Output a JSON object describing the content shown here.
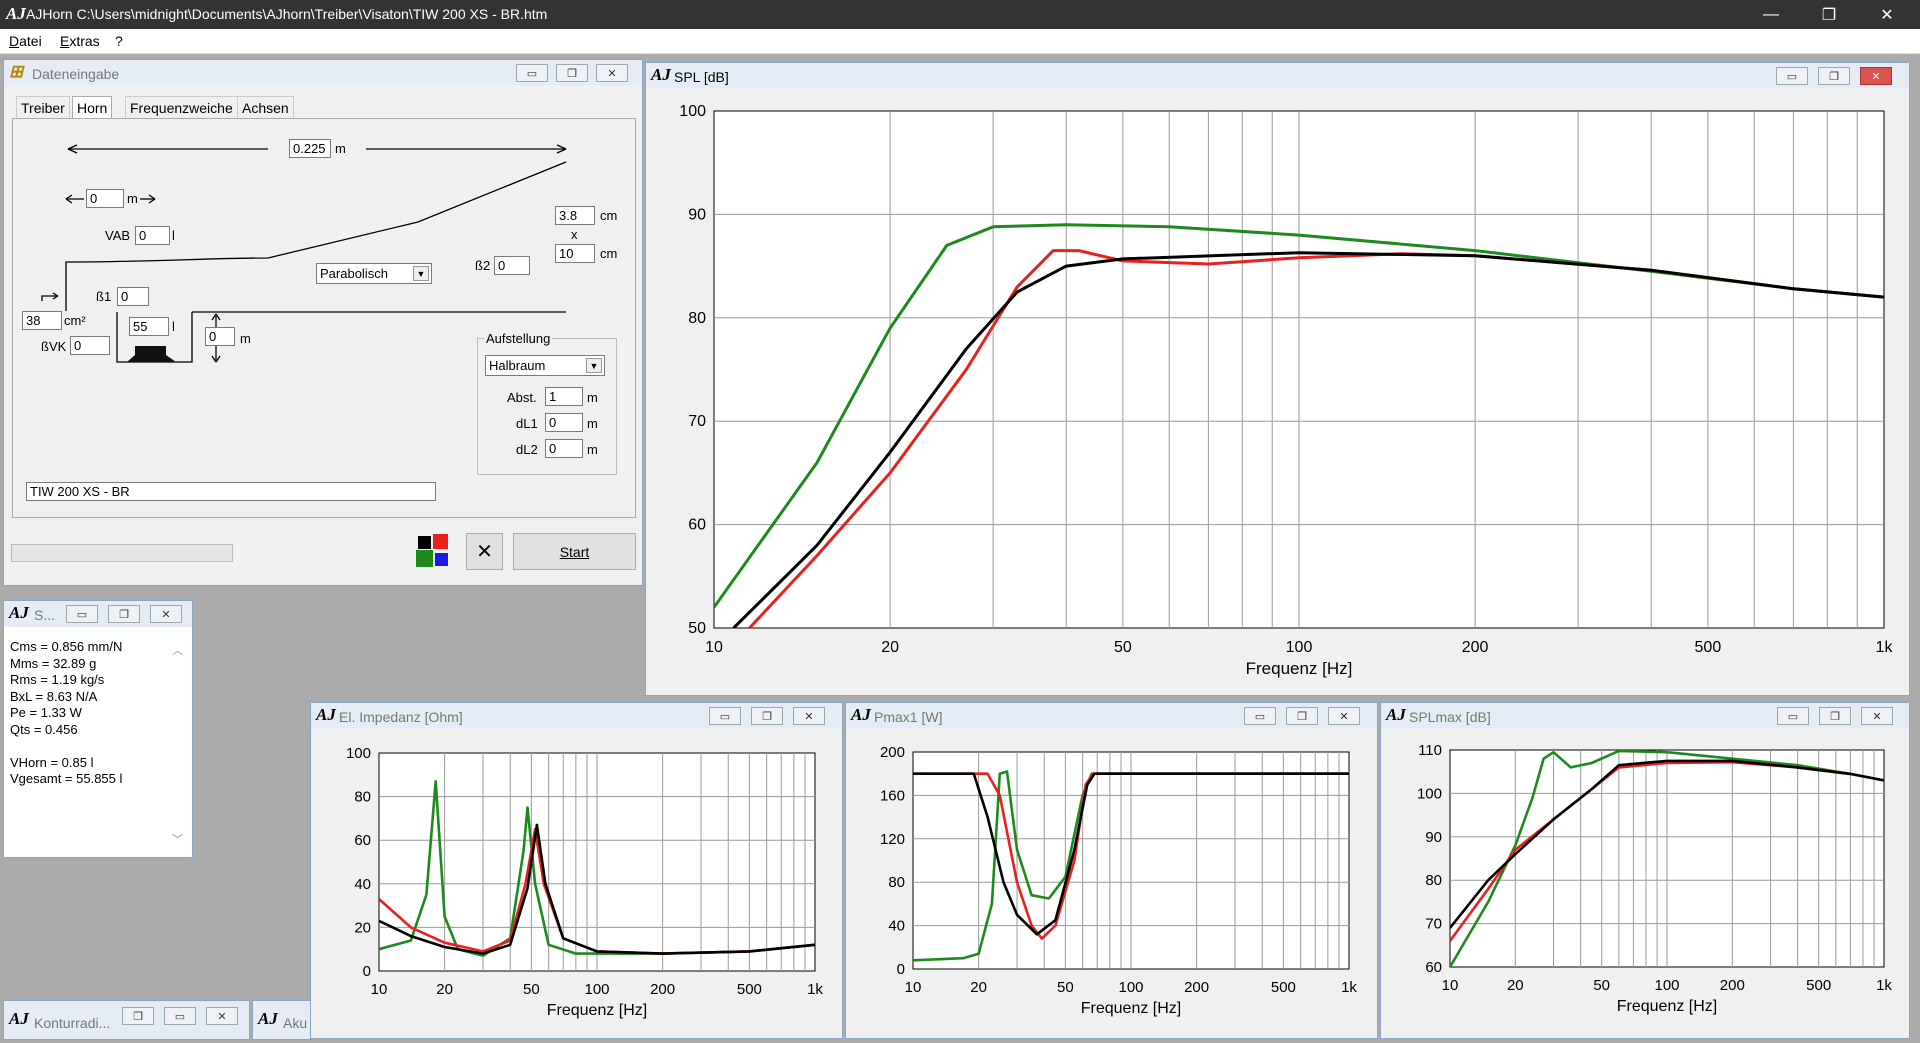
{
  "app": {
    "title": "AJHorn  C:\\Users\\midnight\\Documents\\AJhorn\\Treiber\\Visaton\\TIW 200 XS - BR.htm",
    "logo": "AJ"
  },
  "menu": [
    "Datei",
    "Extras",
    "?"
  ],
  "input_window": {
    "title": "Dateneingabe",
    "tabs": [
      "Treiber",
      "Horn",
      "Frequenzweiche",
      "Achsen"
    ],
    "length_value": "0.225",
    "length_unit": "m",
    "offset_value": "0",
    "offset_unit": "m",
    "vab_label": "VAB",
    "vab_value": "0",
    "vab_unit": "l",
    "throat_w": "3.8",
    "throat_w_unit": "cm",
    "times": "x",
    "throat_h": "10",
    "throat_h_unit": "cm",
    "horn_type": "Parabolisch",
    "b2_label": "ß2",
    "b2_value": "0",
    "b1_label": "ß1",
    "b1_value": "0",
    "area_value": "38",
    "area_unit": "cm²",
    "vol_value": "55",
    "vol_unit": "l",
    "bvk_label": "ßVK",
    "bvk_value": "0",
    "m_value": "0",
    "m_unit": "m",
    "group_title": "Aufstellung",
    "placement": "Halbraum",
    "abst_label": "Abst.",
    "abst_value": "1",
    "abst_unit": "m",
    "dl1_label": "dL1",
    "dl1_value": "0",
    "dl1_unit": "m",
    "dl2_label": "dL2",
    "dl2_value": "0",
    "dl2_unit": "m",
    "name_value": "TIW 200 XS - BR",
    "start_label": "Start",
    "cancel_glyph": "✕"
  },
  "params_window": {
    "title": "S...",
    "lines": [
      "Cms = 0.856 mm/N",
      "Mms = 32.89 g",
      "Rms = 1.19 kg/s",
      "BxL = 8.63 N/A",
      "Pe = 1.33 W",
      "Qts = 0.456",
      "",
      "VHorn = 0.85 l",
      "Vgesamt = 55.855 l"
    ]
  },
  "minimized": [
    {
      "title": "Konturradi..."
    },
    {
      "title": "Aku"
    }
  ],
  "colors": {
    "green": "#1e8a1e",
    "red": "#e8201e",
    "black": "#000000",
    "blue": "#1a1ae8"
  },
  "chart_data": [
    {
      "id": "spl",
      "type": "line",
      "title": "SPL [dB]",
      "xlabel": "Frequenz [Hz]",
      "xscale": "log",
      "xlim": [
        10,
        1000
      ],
      "ylim": [
        50,
        100
      ],
      "xticks": [
        {
          "v": 10,
          "l": "10"
        },
        {
          "v": 20,
          "l": "20"
        },
        {
          "v": 50,
          "l": "50"
        },
        {
          "v": 100,
          "l": "100"
        },
        {
          "v": 200,
          "l": "200"
        },
        {
          "v": 500,
          "l": "500"
        },
        {
          "v": 1000,
          "l": "1k"
        }
      ],
      "yticks": [
        50,
        60,
        70,
        80,
        90,
        100
      ],
      "series": [
        {
          "color": "green",
          "points": [
            [
              10,
              52
            ],
            [
              15,
              66
            ],
            [
              20,
              79
            ],
            [
              25,
              87
            ],
            [
              30,
              88.8
            ],
            [
              40,
              89
            ],
            [
              60,
              88.8
            ],
            [
              100,
              88
            ],
            [
              200,
              86.5
            ],
            [
              400,
              84.5
            ],
            [
              700,
              82.8
            ],
            [
              1000,
              82
            ]
          ]
        },
        {
          "color": "red",
          "points": [
            [
              11.5,
              50
            ],
            [
              15,
              57
            ],
            [
              20,
              65
            ],
            [
              27,
              75
            ],
            [
              33,
              83
            ],
            [
              38,
              86.5
            ],
            [
              42,
              86.5
            ],
            [
              50,
              85.5
            ],
            [
              70,
              85.2
            ],
            [
              100,
              85.8
            ],
            [
              150,
              86.2
            ],
            [
              200,
              86
            ],
            [
              400,
              84.6
            ],
            [
              700,
              82.8
            ],
            [
              1000,
              82
            ]
          ]
        },
        {
          "color": "black",
          "points": [
            [
              10.8,
              50
            ],
            [
              15,
              58
            ],
            [
              20,
              67
            ],
            [
              27,
              77
            ],
            [
              33,
              82.5
            ],
            [
              40,
              85
            ],
            [
              50,
              85.7
            ],
            [
              100,
              86.3
            ],
            [
              200,
              86
            ],
            [
              400,
              84.6
            ],
            [
              700,
              82.8
            ],
            [
              1000,
              82
            ]
          ]
        }
      ]
    },
    {
      "id": "imp",
      "type": "line",
      "title": "El. Impedanz [Ohm]",
      "xlabel": "Frequenz [Hz]",
      "xscale": "log",
      "xlim": [
        10,
        1000
      ],
      "ylim": [
        0,
        100
      ],
      "xticks": [
        {
          "v": 10,
          "l": "10"
        },
        {
          "v": 20,
          "l": "20"
        },
        {
          "v": 50,
          "l": "50"
        },
        {
          "v": 100,
          "l": "100"
        },
        {
          "v": 200,
          "l": "200"
        },
        {
          "v": 500,
          "l": "500"
        },
        {
          "v": 1000,
          "l": "1k"
        }
      ],
      "yticks": [
        0,
        20,
        40,
        60,
        80,
        100
      ],
      "series": [
        {
          "color": "green",
          "points": [
            [
              10,
              10
            ],
            [
              14,
              14
            ],
            [
              16.5,
              35
            ],
            [
              18.2,
              87
            ],
            [
              20,
              25
            ],
            [
              23,
              10
            ],
            [
              30,
              7
            ],
            [
              40,
              15
            ],
            [
              46,
              55
            ],
            [
              48,
              75
            ],
            [
              52,
              40
            ],
            [
              60,
              12
            ],
            [
              80,
              8
            ],
            [
              200,
              8
            ],
            [
              500,
              9
            ],
            [
              1000,
              12
            ]
          ]
        },
        {
          "color": "red",
          "points": [
            [
              10,
              33
            ],
            [
              14,
              20
            ],
            [
              20,
              13
            ],
            [
              30,
              9
            ],
            [
              40,
              14
            ],
            [
              47,
              40
            ],
            [
              52,
              65
            ],
            [
              57,
              40
            ],
            [
              70,
              15
            ],
            [
              100,
              9
            ],
            [
              200,
              8
            ],
            [
              500,
              9
            ],
            [
              1000,
              12
            ]
          ]
        },
        {
          "color": "black",
          "points": [
            [
              10,
              23
            ],
            [
              14,
              16
            ],
            [
              20,
              11
            ],
            [
              30,
              8
            ],
            [
              40,
              12
            ],
            [
              48,
              38
            ],
            [
              53,
              67
            ],
            [
              58,
              40
            ],
            [
              70,
              15
            ],
            [
              100,
              9
            ],
            [
              200,
              8
            ],
            [
              500,
              9
            ],
            [
              1000,
              12
            ]
          ]
        }
      ]
    },
    {
      "id": "pmax",
      "type": "line",
      "title": "Pmax1 [W]",
      "xlabel": "Frequenz [Hz]",
      "xscale": "log",
      "xlim": [
        10,
        1000
      ],
      "ylim": [
        0,
        200
      ],
      "xticks": [
        {
          "v": 10,
          "l": "10"
        },
        {
          "v": 20,
          "l": "20"
        },
        {
          "v": 50,
          "l": "50"
        },
        {
          "v": 100,
          "l": "100"
        },
        {
          "v": 200,
          "l": "200"
        },
        {
          "v": 500,
          "l": "500"
        },
        {
          "v": 1000,
          "l": "1k"
        }
      ],
      "yticks": [
        {
          "v": 0,
          "l": "0"
        },
        {
          "v": 40,
          "l": "40"
        },
        {
          "v": 80,
          "l": "80"
        },
        {
          "v": 120,
          "l": "120"
        },
        {
          "v": 160,
          "l": "160"
        },
        {
          "v": 200,
          "l": "200"
        }
      ],
      "series": [
        {
          "color": "green",
          "points": [
            [
              10,
              8
            ],
            [
              17,
              10
            ],
            [
              20,
              14
            ],
            [
              23,
              60
            ],
            [
              25,
              180
            ],
            [
              27,
              182
            ],
            [
              30,
              110
            ],
            [
              35,
              68
            ],
            [
              42,
              65
            ],
            [
              50,
              85
            ],
            [
              60,
              160
            ],
            [
              66,
              180
            ],
            [
              1000,
              180
            ]
          ]
        },
        {
          "color": "red",
          "points": [
            [
              10,
              180
            ],
            [
              22,
              180
            ],
            [
              25,
              160
            ],
            [
              30,
              80
            ],
            [
              35,
              40
            ],
            [
              39,
              28
            ],
            [
              45,
              40
            ],
            [
              55,
              100
            ],
            [
              62,
              170
            ],
            [
              67,
              180
            ],
            [
              1000,
              180
            ]
          ]
        },
        {
          "color": "black",
          "points": [
            [
              10,
              180
            ],
            [
              19,
              180
            ],
            [
              22,
              140
            ],
            [
              26,
              80
            ],
            [
              30,
              50
            ],
            [
              37,
              32
            ],
            [
              45,
              45
            ],
            [
              55,
              110
            ],
            [
              63,
              170
            ],
            [
              68,
              180
            ],
            [
              1000,
              180
            ]
          ]
        }
      ]
    },
    {
      "id": "splmax",
      "type": "line",
      "title": "SPLmax [dB]",
      "xlabel": "Frequenz [Hz]",
      "xscale": "log",
      "xlim": [
        10,
        1000
      ],
      "ylim": [
        60,
        110
      ],
      "xticks": [
        {
          "v": 10,
          "l": "10"
        },
        {
          "v": 20,
          "l": "20"
        },
        {
          "v": 50,
          "l": "50"
        },
        {
          "v": 100,
          "l": "100"
        },
        {
          "v": 200,
          "l": "200"
        },
        {
          "v": 500,
          "l": "500"
        },
        {
          "v": 1000,
          "l": "1k"
        }
      ],
      "yticks": [
        60,
        70,
        80,
        90,
        100,
        110
      ],
      "series": [
        {
          "color": "green",
          "points": [
            [
              10,
              60
            ],
            [
              15,
              75
            ],
            [
              20,
              88
            ],
            [
              24,
              99
            ],
            [
              27,
              108
            ],
            [
              30,
              109.5
            ],
            [
              36,
              106
            ],
            [
              45,
              107
            ],
            [
              60,
              109.8
            ],
            [
              100,
              109.5
            ],
            [
              200,
              108
            ],
            [
              400,
              106.5
            ],
            [
              700,
              104.5
            ],
            [
              1000,
              103
            ]
          ]
        },
        {
          "color": "red",
          "points": [
            [
              10,
              66
            ],
            [
              15,
              78
            ],
            [
              20,
              87
            ],
            [
              30,
              94
            ],
            [
              45,
              101
            ],
            [
              60,
              106
            ],
            [
              100,
              107
            ],
            [
              200,
              107.2
            ],
            [
              400,
              106
            ],
            [
              700,
              104.5
            ],
            [
              1000,
              103
            ]
          ]
        },
        {
          "color": "black",
          "points": [
            [
              10,
              69
            ],
            [
              15,
              80
            ],
            [
              20,
              86
            ],
            [
              30,
              94
            ],
            [
              45,
              101
            ],
            [
              60,
              106.5
            ],
            [
              100,
              107.5
            ],
            [
              200,
              107.5
            ],
            [
              400,
              106
            ],
            [
              700,
              104.5
            ],
            [
              1000,
              103
            ]
          ]
        }
      ]
    }
  ]
}
